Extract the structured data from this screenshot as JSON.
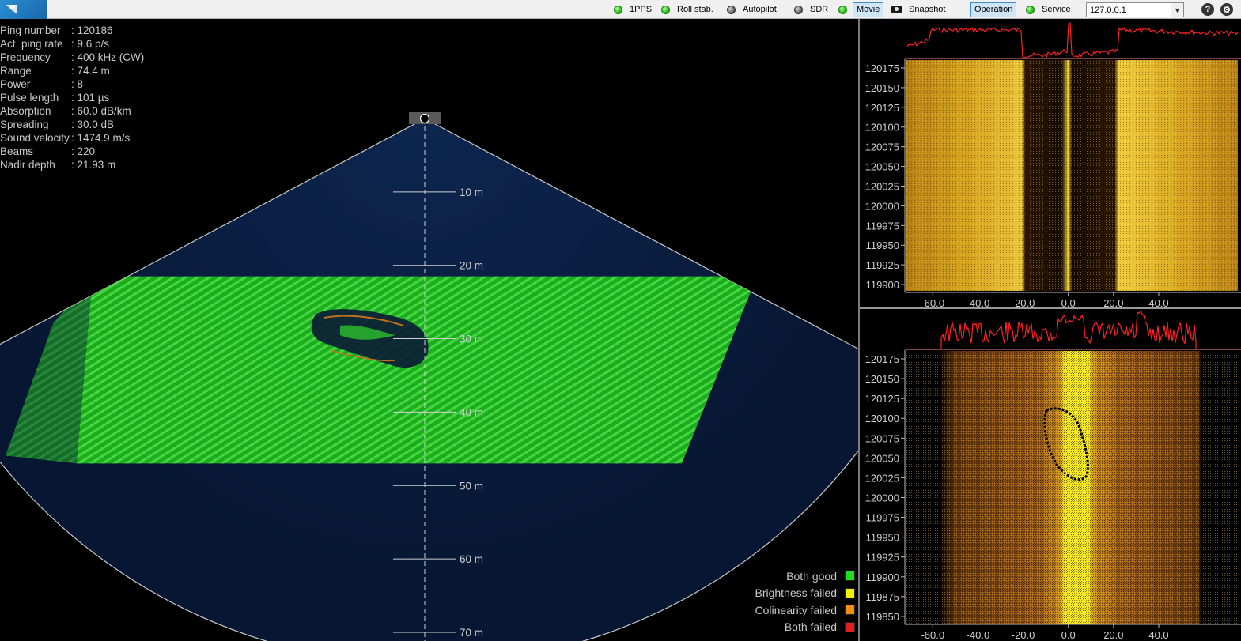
{
  "toolbar": {
    "indicators": [
      {
        "label": "1PPS",
        "state": "on"
      },
      {
        "label": "Roll stab.",
        "state": "on"
      },
      {
        "label": "Autopilot",
        "state": "off"
      },
      {
        "label": "SDR",
        "state": "off"
      },
      {
        "label": "Movie",
        "state": "on"
      }
    ],
    "snapshot_label": "Snapshot",
    "operation_label": "Operation",
    "service_label": "Service",
    "service_state": "on",
    "ip_value": "127.0.0.1",
    "help_icon": "help-icon",
    "settings_icon": "settings-icon",
    "help_glyph": "?",
    "settings_glyph": "⚙"
  },
  "status": [
    {
      "key": "Ping number",
      "value": ": 120186"
    },
    {
      "key": "Act. ping rate",
      "value": ": 9.6 p/s"
    },
    {
      "key": "Frequency",
      "value": ": 400 kHz (CW)"
    },
    {
      "key": "Range",
      "value": ": 74.4 m"
    },
    {
      "key": "Power",
      "value": ": 8"
    },
    {
      "key": "Pulse length",
      "value": ": 101 µs"
    },
    {
      "key": "Absorption",
      "value": ": 60.0 dB/km"
    },
    {
      "key": "Spreading",
      "value": ": 30.0 dB"
    },
    {
      "key": "Sound velocity",
      "value": ": 1474.9 m/s"
    },
    {
      "key": "Beams",
      "value": ": 220"
    },
    {
      "key": "Nadir depth",
      "value": ": 21.93 m"
    }
  ],
  "fan": {
    "range_labels": [
      "10 m",
      "20 m",
      "30 m",
      "40 m",
      "50 m",
      "60 m",
      "70 m"
    ],
    "range_values": [
      10,
      20,
      30,
      40,
      50,
      60,
      70
    ],
    "max_range": 74.4,
    "bottom_depth_top": 21.5,
    "bottom_depth_bottom": 47
  },
  "legend": [
    {
      "label": "Both good",
      "color": "#22dd22"
    },
    {
      "label": "Brightness failed",
      "color": "#f0f000"
    },
    {
      "label": "Colinearity failed",
      "color": "#f08c10"
    },
    {
      "label": "Both failed",
      "color": "#e02020"
    }
  ],
  "waterfall_top": {
    "y_ticks": [
      "120175",
      "120150",
      "120125",
      "120100",
      "120075",
      "120050",
      "120025",
      "120000",
      "119975",
      "119950",
      "119925",
      "119900"
    ],
    "x_ticks": [
      "-60.0",
      "-40.0",
      "-20.0",
      "0.0",
      "20.0",
      "40.0"
    ],
    "x_values": [
      -60,
      -40,
      -20,
      0,
      20,
      40
    ],
    "x_range": [
      -72,
      75
    ]
  },
  "waterfall_bottom": {
    "y_ticks": [
      "120175",
      "120150",
      "120125",
      "120100",
      "120075",
      "120050",
      "120025",
      "120000",
      "119975",
      "119950",
      "119925",
      "119900",
      "119875",
      "119850"
    ],
    "x_ticks": [
      "-60.0",
      "-40.0",
      "-20.0",
      "0.0",
      "20.0",
      "40.0"
    ],
    "x_values": [
      -60,
      -40,
      -20,
      0,
      20,
      40
    ],
    "x_range": [
      -72,
      75
    ]
  }
}
